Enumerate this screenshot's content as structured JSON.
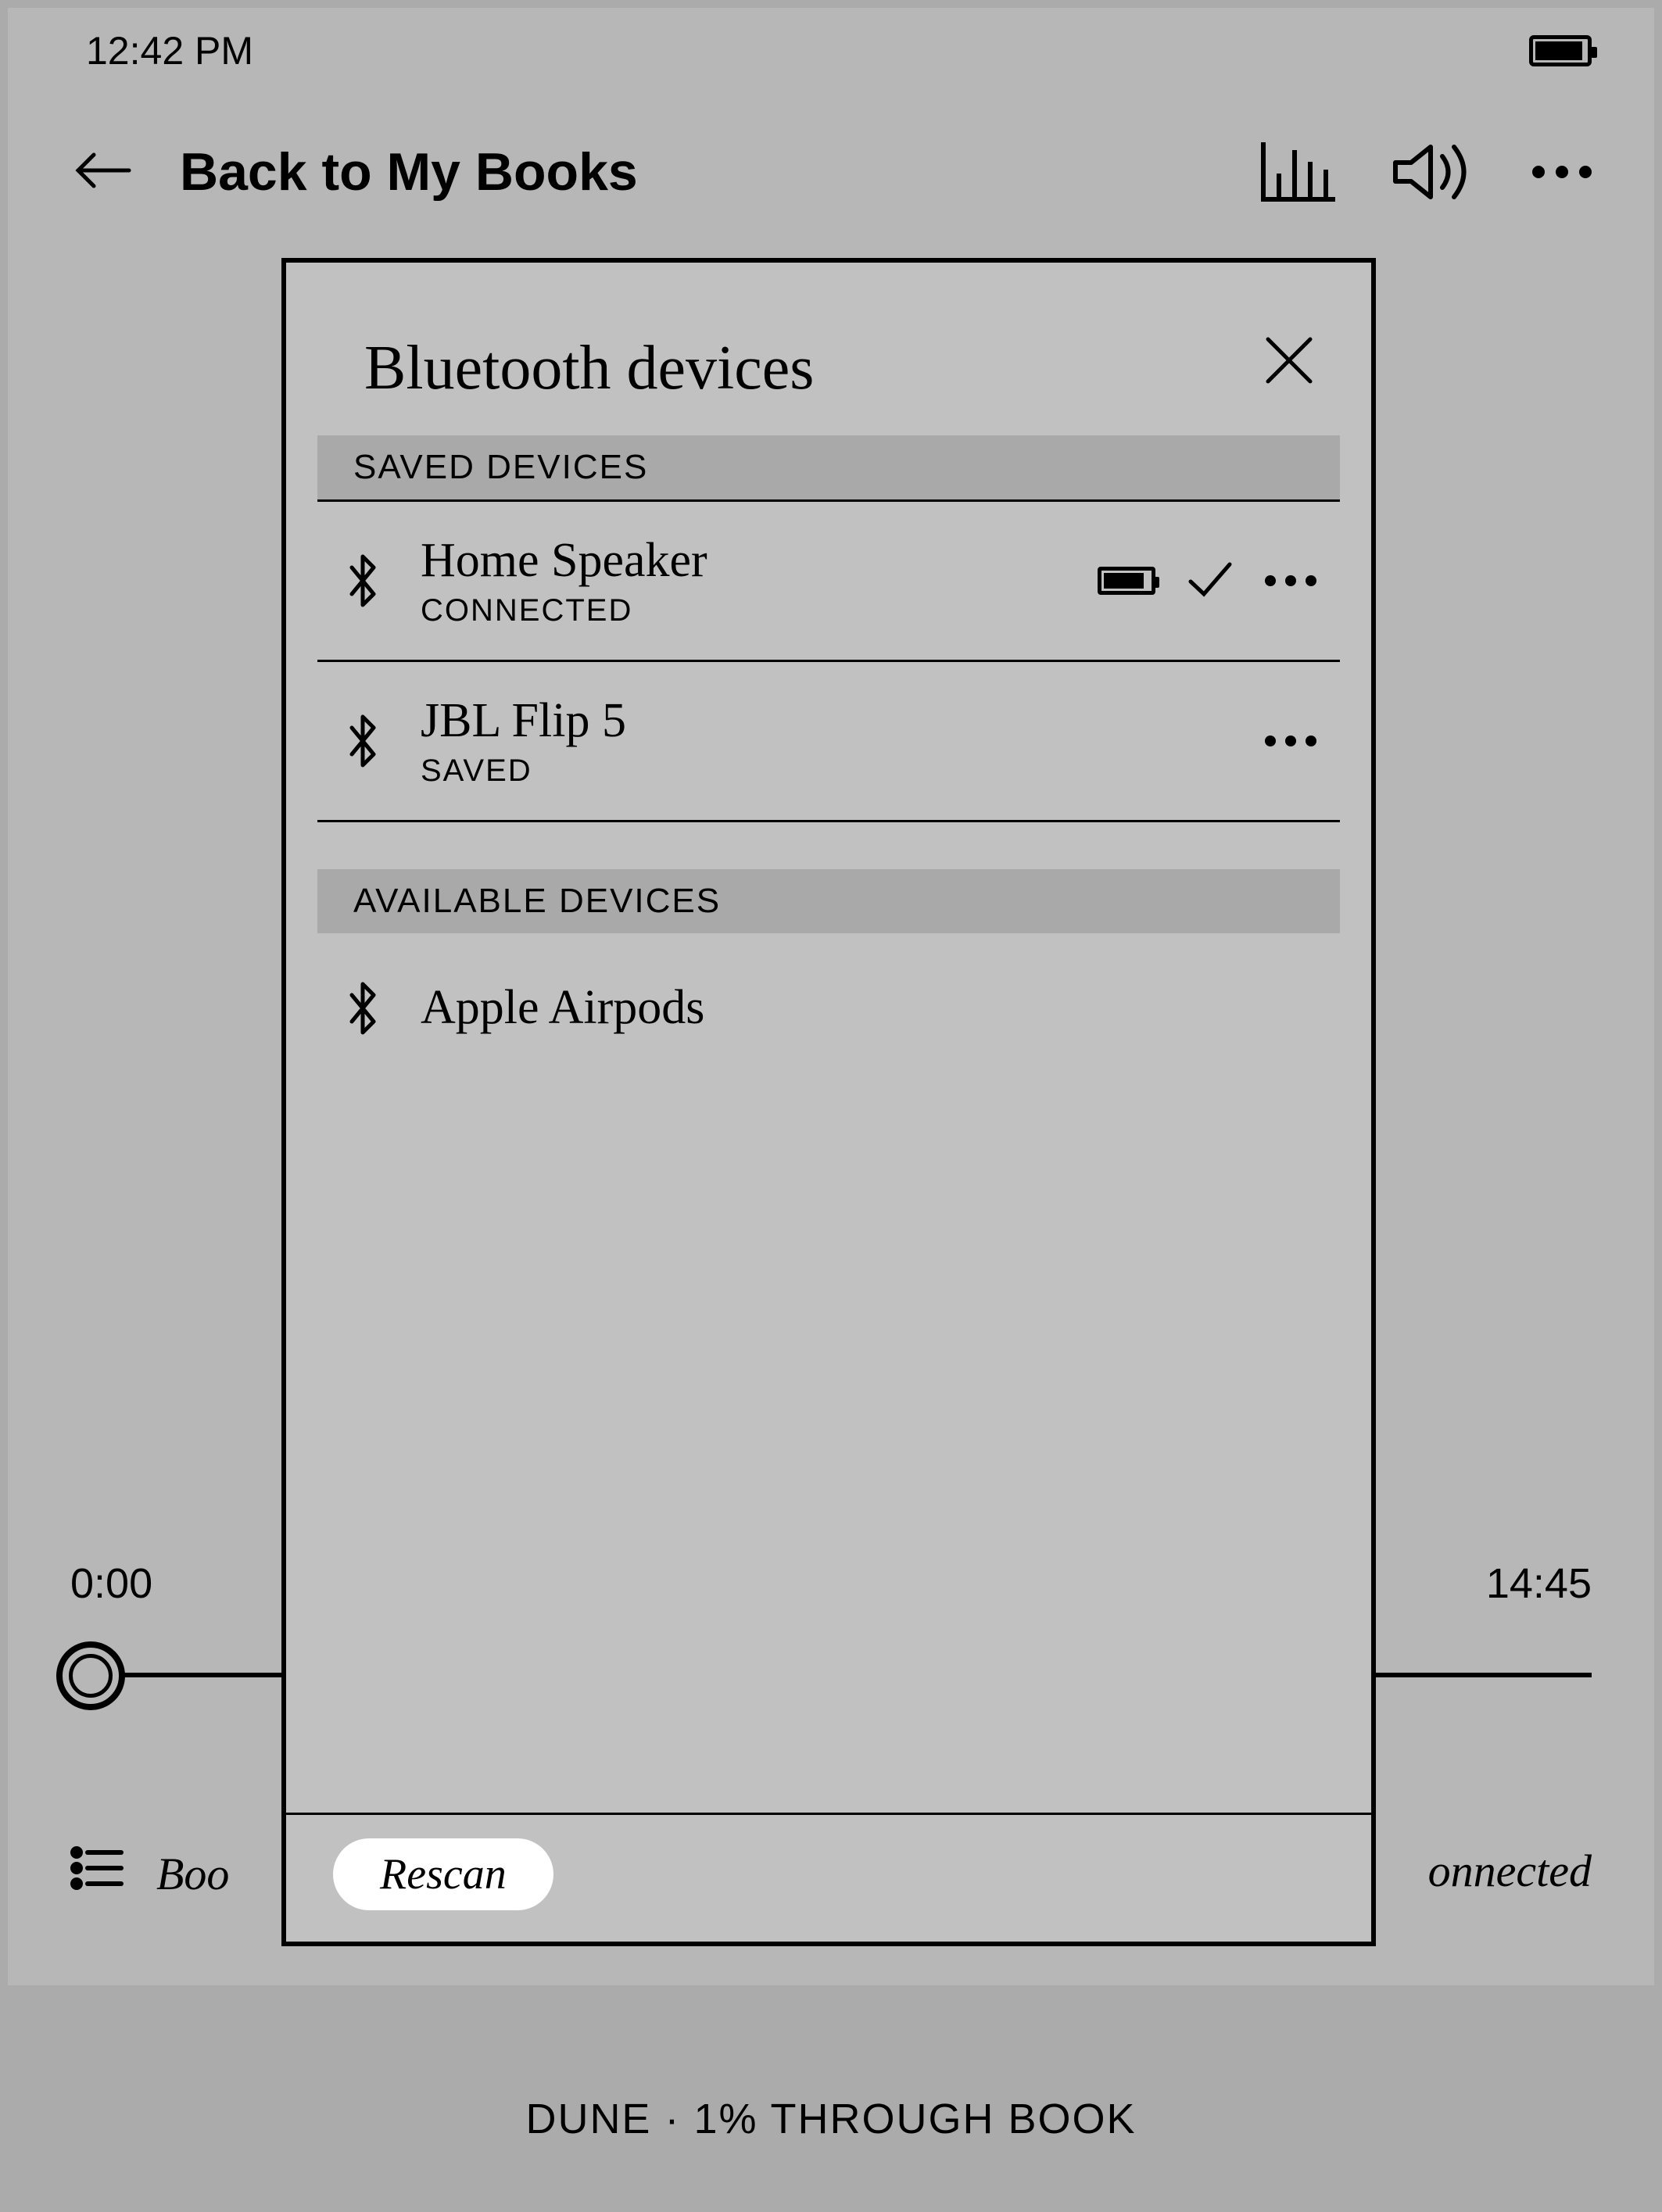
{
  "statusbar": {
    "time": "12:42 PM"
  },
  "header": {
    "back_label": "Back to My Books"
  },
  "playback": {
    "elapsed": "0:00",
    "remaining": "14:45",
    "bottom_left_text": "Boo",
    "bottom_right_text": "onnected"
  },
  "progress": {
    "text": "DUNE · 1% THROUGH BOOK"
  },
  "modal": {
    "title": "Bluetooth devices",
    "saved_header": "SAVED DEVICES",
    "available_header": "AVAILABLE DEVICES",
    "saved": [
      {
        "name": "Home Speaker",
        "status": "CONNECTED",
        "connected": true
      },
      {
        "name": "JBL Flip 5",
        "status": "SAVED",
        "connected": false
      }
    ],
    "available": [
      {
        "name": "Apple Airpods"
      }
    ],
    "rescan_label": "Rescan"
  }
}
